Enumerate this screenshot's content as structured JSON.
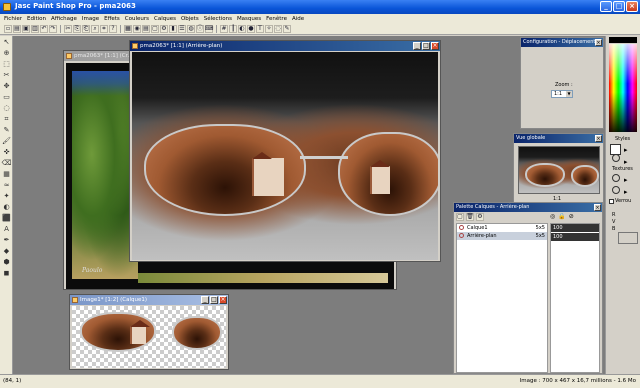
{
  "app": {
    "title": "Jasc Paint Shop Pro - pma2063"
  },
  "menu": [
    "Fichier",
    "Edition",
    "Affichage",
    "Image",
    "Effets",
    "Couleurs",
    "Calques",
    "Objets",
    "Sélections",
    "Masques",
    "Fenêtre",
    "Aide"
  ],
  "toolbar_icons": [
    "new-icon",
    "open-icon",
    "save-icon",
    "print-icon",
    "undo-icon",
    "redo-icon",
    "cut-icon",
    "copy-icon",
    "paste-icon",
    "zoom-icon",
    "crop-icon",
    "help-icon",
    "browse-icon",
    "palette-icon",
    "layers-icon",
    "overview-icon",
    "tool-options-icon",
    "histogram-icon",
    "script-icon",
    "web-icon",
    "info-icon",
    "keyboard-icon",
    "grid-icon",
    "ruler-icon",
    "mask-icon",
    "color-icon",
    "text-icon",
    "magic-icon",
    "lasso-icon",
    "pen-icon"
  ],
  "tool_icons": [
    "↖",
    "⊕",
    "⬚",
    "✂",
    "✥",
    "▭",
    "◌",
    "⌗",
    "✎",
    "🖌",
    "✜",
    "⌫",
    "▦",
    "≈",
    "✦",
    "◐",
    "⬛",
    "A",
    "✒",
    "◆",
    "⬢",
    "◼"
  ],
  "windows": {
    "back_doc": {
      "title": "pma2063* [1:1] (Cr..."
    },
    "front_doc": {
      "title": "pma2063* [1:1] (Arrière-plan)"
    },
    "image_doc": {
      "title": "Image1* [1:2] (Calque1)"
    }
  },
  "config_palette": {
    "title": "Configuration - Déplacement",
    "zoom_label": "Zoom :",
    "zoom_value": "1:1"
  },
  "overview_palette": {
    "title": "Vue globale",
    "zoom": "1:1"
  },
  "layers_palette": {
    "title": "Palette Calques - Arrière-plan",
    "layers": [
      {
        "name": "Calque1",
        "blend": "5x5"
      },
      {
        "name": "Arrière-plan",
        "blend": "5x5"
      }
    ],
    "opacities": [
      "100",
      "100"
    ]
  },
  "color_panel": {
    "styles_label": "Styles",
    "textures_label": "Textures",
    "recent_label": "Verrou",
    "rvb_labels": [
      "R",
      "V",
      "B"
    ]
  },
  "status": {
    "coords": "(84, 1)",
    "image_info": "Image : 700 x 467 x 16,7 millions - 1.6 Mo"
  },
  "photo_signature": "Paoulo"
}
